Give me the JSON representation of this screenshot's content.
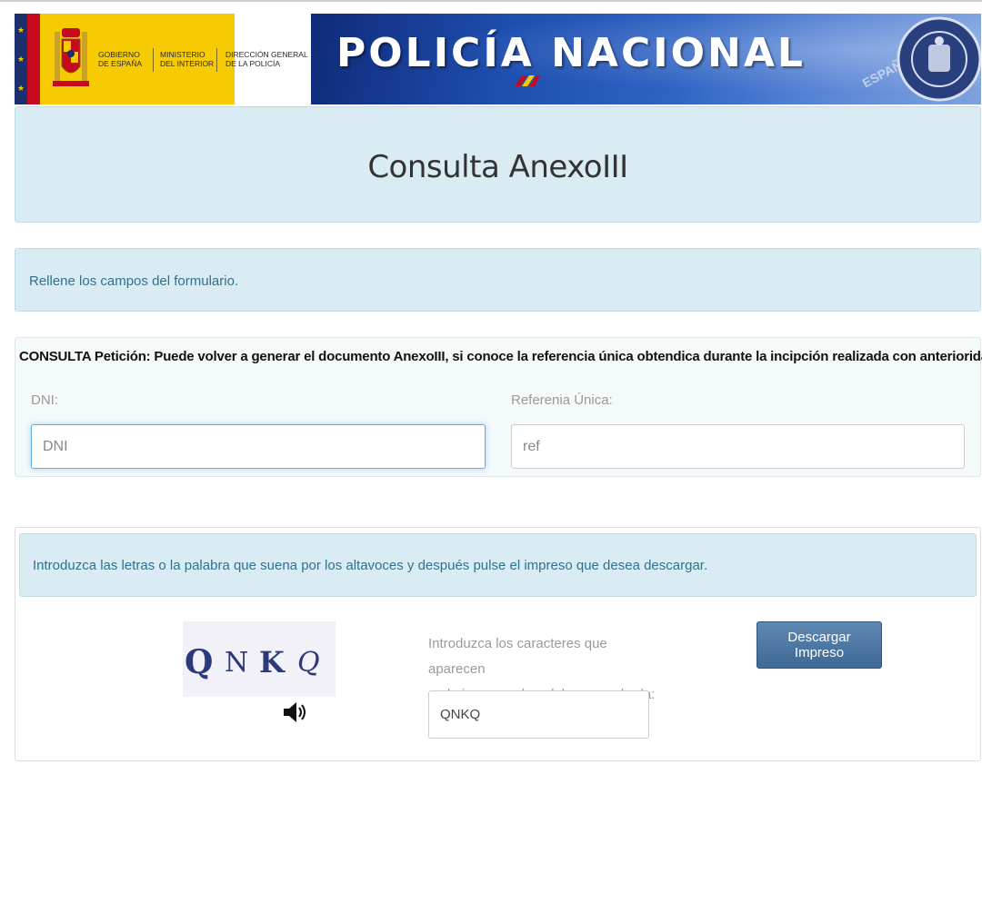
{
  "header": {
    "gobierno": [
      "GOBIERNO",
      "DE ESPAÑA"
    ],
    "ministerio": [
      "MINISTERIO",
      "DEL INTERIOR"
    ],
    "direccion": [
      "DIRECCIÓN GENERAL",
      "DE LA POLICÍA"
    ],
    "police_title": "POLICÍA NACIONAL",
    "espana_watermark": "ESPAÑA"
  },
  "main": {
    "title": "Consulta AnexoIII",
    "info_message": "Rellene los campos del formulario.",
    "consulta_text": "CONSULTA Petición: Puede volver a generar el documento AnexoIII, si conoce la referencia única obtendica durante la incipción realizada con anterioridad."
  },
  "form": {
    "dni_label": "DNI:",
    "dni_placeholder": "DNI",
    "ref_label": "Referenia Única:",
    "ref_placeholder": "ref"
  },
  "captcha": {
    "info": "Introduzca las letras o la palabra que suena por los altavoces y después pulse el impreso que desea descargar.",
    "chars": [
      "Q",
      "N",
      "K",
      "Q"
    ],
    "label_line1": "Introduzca los caracteres que aparecen",
    "label_line2": "en la imagen o la palabra escuchada:",
    "input_value": "QNKQ",
    "button_label": "Descargar Impreso",
    "speaker_icon": "speaker-icon"
  },
  "colors": {
    "panel_bg": "#d9ecf4",
    "info_text": "#31708f",
    "button": "#3d6996",
    "banner_blue": "#1e4fb0",
    "gov_yellow": "#f6cb04"
  }
}
